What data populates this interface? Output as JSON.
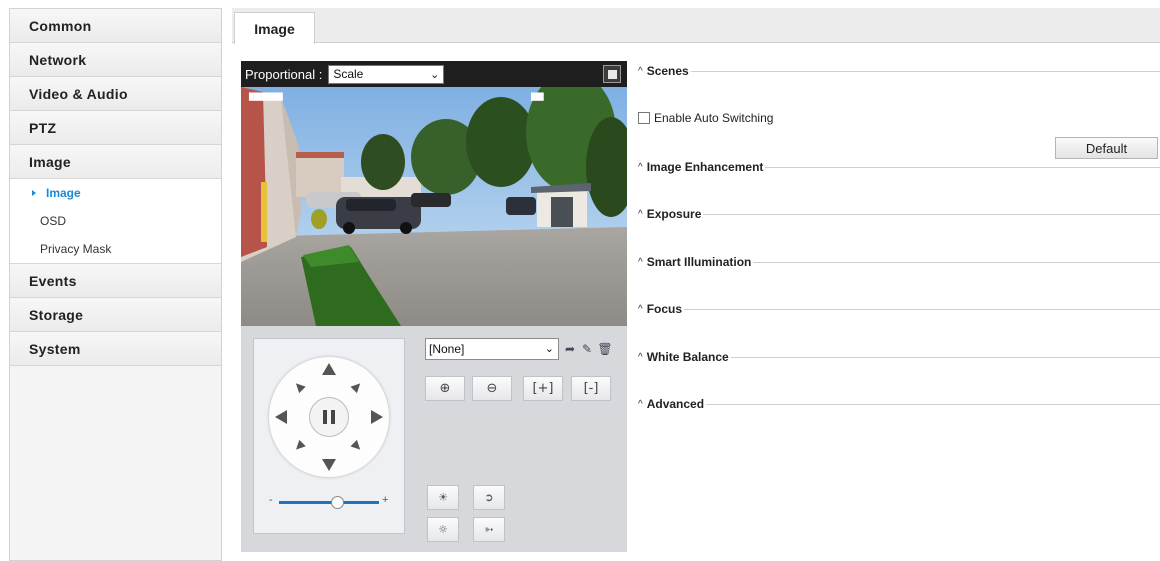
{
  "sidebar": {
    "groups": [
      {
        "label": "Common"
      },
      {
        "label": "Network"
      },
      {
        "label": "Video & Audio"
      },
      {
        "label": "PTZ"
      },
      {
        "label": "Image"
      },
      {
        "label": "Events"
      },
      {
        "label": "Storage"
      },
      {
        "label": "System"
      }
    ],
    "image_items": [
      {
        "label": "Image",
        "active": true
      },
      {
        "label": "OSD"
      },
      {
        "label": "Privacy Mask"
      }
    ]
  },
  "tabs": [
    {
      "label": "Image",
      "active": true
    }
  ],
  "video": {
    "mode_label": "Proportional :",
    "mode_value": "Scale"
  },
  "ptz": {
    "preset_value": "[None]",
    "zoom_in_icon": "zoom-in-icon",
    "zoom_out_icon": "zoom-out-icon",
    "speed_minus": "-",
    "speed_plus": "+"
  },
  "settings": {
    "sections": [
      {
        "label": "Scenes"
      },
      {
        "label": "Image Enhancement"
      },
      {
        "label": "Exposure"
      },
      {
        "label": "Smart Illumination"
      },
      {
        "label": "Focus"
      },
      {
        "label": "White Balance"
      },
      {
        "label": "Advanced"
      }
    ],
    "auto_switching_label": "Enable Auto Switching",
    "auto_switching_checked": false,
    "default_button": "Default"
  },
  "colors": {
    "accent": "#1c8ad6",
    "slider": "#1e73c2"
  }
}
